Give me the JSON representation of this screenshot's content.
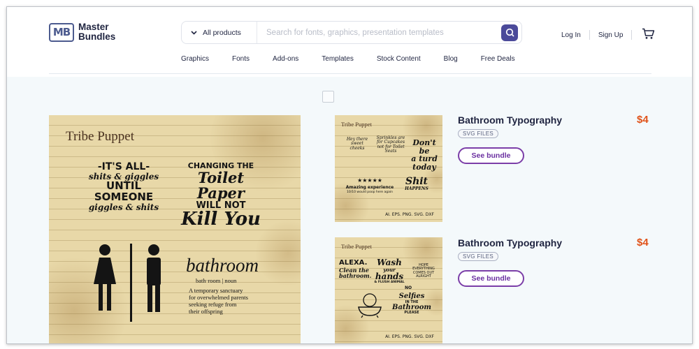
{
  "header": {
    "logo_mark": "MB",
    "logo_line1": "Master",
    "logo_line2": "Bundles",
    "search": {
      "category": "All products",
      "placeholder": "Search for fonts, graphics, presentation templates"
    },
    "auth": {
      "login": "Log In",
      "signup": "Sign Up"
    },
    "nav": [
      "Graphics",
      "Fonts",
      "Add-ons",
      "Templates",
      "Stock Content",
      "Blog",
      "Free Deals"
    ]
  },
  "main_image": {
    "brand": "Tribe Puppet",
    "quote1": [
      "-IT'S ALL-",
      "shits & giggles",
      "UNTIL",
      "SOMEONE",
      "giggles & shits"
    ],
    "quote2": [
      "CHANGING THE",
      "Toilet Paper",
      "WILL NOT",
      "Kill You"
    ],
    "bathroom_word": "bathroom",
    "bathroom_pron": "bath·room | noun",
    "bathroom_def": [
      "A temporary sanctuary",
      "for overwhelmed parents",
      "seeking refuge from",
      "their offspring"
    ]
  },
  "thumb1": {
    "brand": "Tribe Puppet",
    "t1": "Hey there sweet cheeks",
    "t2": "Sprinkles are for Cupcakes not for Toilet Seats",
    "t3": [
      "Don't be",
      "a turd",
      "today"
    ],
    "stars": "★★★★★",
    "t4": "Amazing experience",
    "t5": "10/10 would poop here again",
    "t6": [
      "Shit",
      "HAPPENS"
    ],
    "formats": "AI. EPS. PNG. SVG. DXF"
  },
  "thumb2": {
    "brand": "Tribe Puppet",
    "t1": [
      "ALEXA.",
      "Clean the",
      "bathroom."
    ],
    "t2": [
      "Wash",
      "your",
      "hands"
    ],
    "t2b": "& FLUSH ANIMAL",
    "t3": "HOPE EVERYTHING COMES OUT ALRIGHT",
    "t4": "NO",
    "t5": [
      "Selfies",
      "IN THE",
      "Bathroom"
    ],
    "t6": "PLEASE",
    "formats": "AI. EPS. PNG. SVG. DXF"
  },
  "products": [
    {
      "title": "Bathroom Typography",
      "badge": "SVG FILES",
      "button": "See bundle",
      "price": "$4"
    },
    {
      "title": "Bathroom Typography",
      "badge": "SVG FILES",
      "button": "See bundle",
      "price": "$4"
    }
  ],
  "colors": {
    "accent_purple": "#7b3ea8",
    "price_orange": "#e0531a",
    "search_button": "#4b4a9a"
  }
}
